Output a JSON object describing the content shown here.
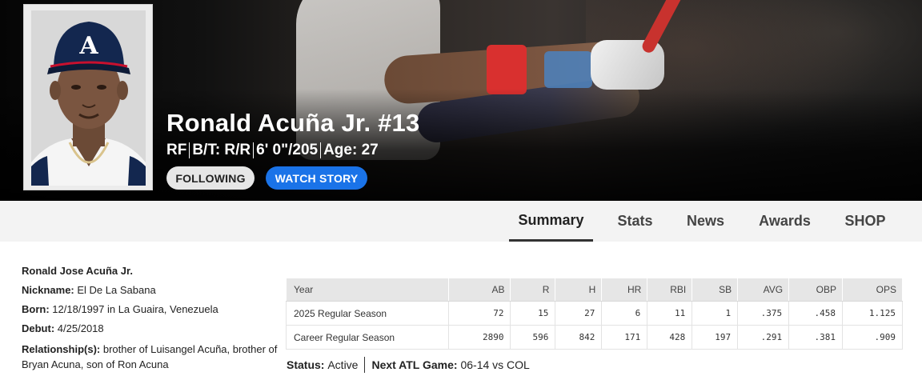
{
  "hero": {
    "player_name": "Ronald Acuña Jr. #13",
    "position": "RF",
    "bats_throws": "B/T: R/R",
    "height_weight": "6' 0\"/205",
    "age": "Age: 27",
    "follow_label": "FOLLOWING",
    "watch_label": "WATCH STORY",
    "colors": {
      "watch_button": "#1a73e8",
      "follow_button": "#e6e6e6"
    }
  },
  "nav": {
    "tabs": [
      {
        "label": "Summary",
        "active": true
      },
      {
        "label": "Stats"
      },
      {
        "label": "News"
      },
      {
        "label": "Awards"
      },
      {
        "label": "SHOP"
      }
    ]
  },
  "info": {
    "full_name": "Ronald Jose Acuña Jr.",
    "nickname_label": "Nickname:",
    "nickname": "El De La Sabana",
    "born_label": "Born:",
    "born": "12/18/1997 in La Guaira, Venezuela",
    "debut_label": "Debut:",
    "debut": "4/25/2018",
    "relationships_label": "Relationship(s):",
    "relationships": "brother of Luisangel Acuña, brother of Bryan Acuna, son of Ron Acuna"
  },
  "stats": {
    "headers": [
      "Year",
      "AB",
      "R",
      "H",
      "HR",
      "RBI",
      "SB",
      "AVG",
      "OBP",
      "OPS"
    ],
    "rows": [
      [
        "2025 Regular Season",
        "72",
        "15",
        "27",
        "6",
        "11",
        "1",
        ".375",
        ".458",
        "1.125"
      ],
      [
        "Career Regular Season",
        "2890",
        "596",
        "842",
        "171",
        "428",
        "197",
        ".291",
        ".381",
        ".909"
      ]
    ]
  },
  "status": {
    "status_label": "Status:",
    "status_value": "Active",
    "next_game_label": "Next ATL Game:",
    "next_game_value": "06-14 vs COL"
  }
}
